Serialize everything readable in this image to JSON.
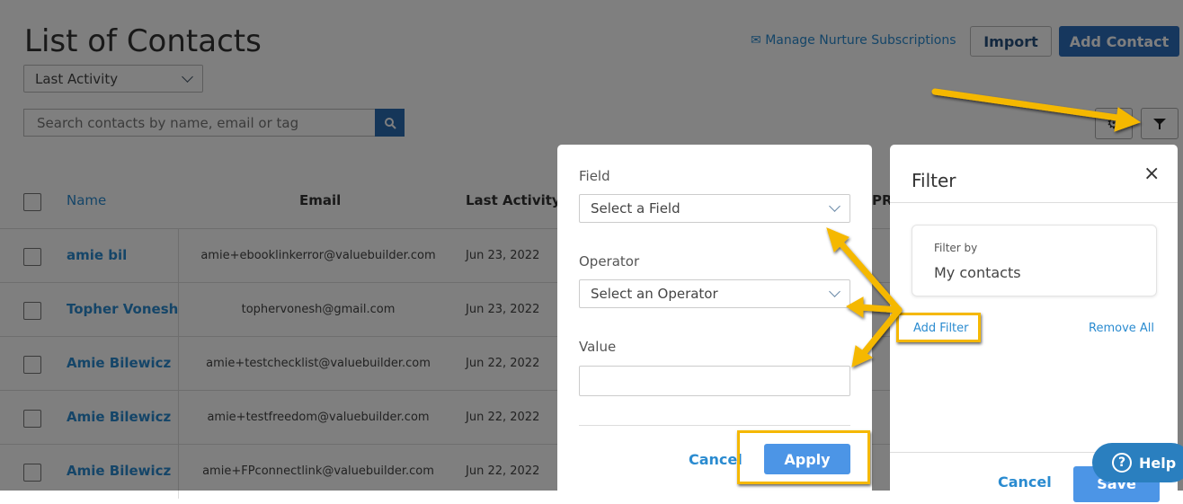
{
  "page": {
    "title": "List of Contacts",
    "sort_value": "Last Activity",
    "search_placeholder": "Search contacts by name, email or tag",
    "manage_link": "Manage Nurture Subscriptions",
    "import_label": "Import",
    "add_contact_label": "Add Contact"
  },
  "table": {
    "headers": {
      "name": "Name",
      "email": "Email",
      "last_activity": "Last Activity",
      "col4": "PR"
    },
    "rows": [
      {
        "name": "amie bil",
        "email": "amie+ebooklinkerror@valuebuilder.com",
        "date": "Jun 23, 2022"
      },
      {
        "name": "Topher Vonesh",
        "email": "tophervonesh@gmail.com",
        "date": "Jun 23, 2022"
      },
      {
        "name": "Amie Bilewicz",
        "email": "amie+testchecklist@valuebuilder.com",
        "date": "Jun 22, 2022"
      },
      {
        "name": "Amie Bilewicz",
        "email": "amie+testfreedom@valuebuilder.com",
        "date": "Jun 22, 2022"
      },
      {
        "name": "Amie Bilewicz",
        "email": "amie+FPconnectlink@valuebuilder.com",
        "date": "Jun 22, 2022"
      }
    ]
  },
  "field_panel": {
    "field_label": "Field",
    "field_placeholder": "Select a Field",
    "operator_label": "Operator",
    "operator_placeholder": "Select an Operator",
    "value_label": "Value",
    "value": "",
    "cancel": "Cancel",
    "apply": "Apply"
  },
  "filter_panel": {
    "title": "Filter",
    "filter_by_label": "Filter by",
    "filter_by_value": "My contacts",
    "add_filter": "Add Filter",
    "remove_all": "Remove All",
    "cancel": "Cancel",
    "save": "Save"
  },
  "help": {
    "label": "Help"
  },
  "colors": {
    "accent": "#2d6ebd",
    "link": "#2a8bd0",
    "highlight": "#f5b800"
  }
}
